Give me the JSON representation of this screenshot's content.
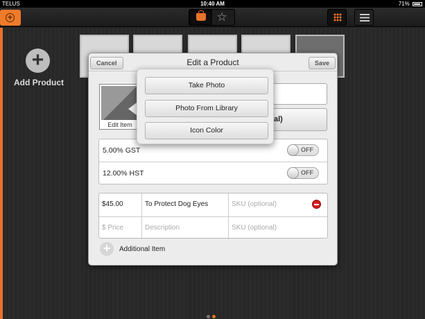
{
  "status_bar": {
    "carrier": "TELUS",
    "time": "10:40 AM",
    "battery": "71%"
  },
  "colors": {
    "accent": "#e8722a",
    "remove": "#d02020"
  },
  "sidebar": {
    "add_product_label": "Add Product"
  },
  "dialog": {
    "title": "Edit a Product",
    "cancel_label": "Cancel",
    "save_label": "Save",
    "photo_label": "Edit Item",
    "optional_field_text": "al)",
    "taxes": [
      {
        "label": "5.00% GST",
        "toggle": "OFF"
      },
      {
        "label": "12.00% HST",
        "toggle": "OFF"
      }
    ],
    "items": [
      {
        "price": "$45.00",
        "description": "To Protect Dog Eyes",
        "sku_placeholder": "SKU (optional)"
      },
      {
        "price_placeholder": "$ Price",
        "description_placeholder": "Description",
        "sku_placeholder": "SKU (optional)"
      }
    ],
    "additional_item_label": "Additional Item"
  },
  "popover": {
    "take_photo": "Take Photo",
    "photo_from_library": "Photo From Library",
    "icon_color": "Icon Color"
  }
}
